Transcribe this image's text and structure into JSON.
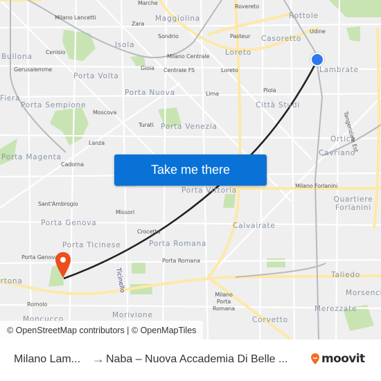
{
  "map": {
    "labels": [
      {
        "text": "Milano Lancetti",
        "kind": "station"
      },
      {
        "text": "Marche",
        "kind": "station"
      },
      {
        "text": "Maggiolina",
        "kind": "district"
      },
      {
        "text": "Zara",
        "kind": "station"
      },
      {
        "text": "Sondrio",
        "kind": "station"
      },
      {
        "text": "Isola",
        "kind": "district"
      },
      {
        "text": "Bullona",
        "kind": "district"
      },
      {
        "text": "Cenisio",
        "kind": "station"
      },
      {
        "text": "Gerusalemme",
        "kind": "station"
      },
      {
        "text": "Gioia",
        "kind": "station"
      },
      {
        "text": "Milano Centrale",
        "kind": "station"
      },
      {
        "text": "Centrale FS",
        "kind": "station"
      },
      {
        "text": "Porta Volta",
        "kind": "district"
      },
      {
        "text": "Porta Nuova",
        "kind": "district"
      },
      {
        "text": "Rovereto",
        "kind": "station"
      },
      {
        "text": "Rottole",
        "kind": "district"
      },
      {
        "text": "Udine",
        "kind": "station"
      },
      {
        "text": "Pasteur",
        "kind": "station"
      },
      {
        "text": "Casoretto",
        "kind": "district"
      },
      {
        "text": "Loreto",
        "kind": "district"
      },
      {
        "text": "Loreto",
        "kind": "station"
      },
      {
        "text": "Lambrate",
        "kind": "district"
      },
      {
        "text": "Lima",
        "kind": "station"
      },
      {
        "text": "Piola",
        "kind": "station"
      },
      {
        "text": "Città Studi",
        "kind": "district"
      },
      {
        "text": "Fiera",
        "kind": "district"
      },
      {
        "text": "Porta Sempione",
        "kind": "district"
      },
      {
        "text": "Moscova",
        "kind": "station"
      },
      {
        "text": "Turati",
        "kind": "station"
      },
      {
        "text": "Porta Venezia",
        "kind": "district"
      },
      {
        "text": "Lanza",
        "kind": "station"
      },
      {
        "text": "Porta Magenta",
        "kind": "district"
      },
      {
        "text": "Cadorna",
        "kind": "station"
      },
      {
        "text": "Ortica",
        "kind": "district"
      },
      {
        "text": "Cavriano",
        "kind": "district"
      },
      {
        "text": "Tangenziale Est",
        "kind": "road"
      },
      {
        "text": "Duomo",
        "kind": "station"
      },
      {
        "text": "Porta Vittoria",
        "kind": "district"
      },
      {
        "text": "Milano Forlanini",
        "kind": "station"
      },
      {
        "text": "Quartiere Forlanini",
        "kind": "district"
      },
      {
        "text": "Sant'Ambrogio",
        "kind": "station"
      },
      {
        "text": "Missori",
        "kind": "station"
      },
      {
        "text": "Porta Genova",
        "kind": "district"
      },
      {
        "text": "Crocetta",
        "kind": "station"
      },
      {
        "text": "Porta Romana",
        "kind": "district"
      },
      {
        "text": "Porta Ticinese",
        "kind": "district"
      },
      {
        "text": "Porta Romana",
        "kind": "station"
      },
      {
        "text": "Porta Genova FS",
        "kind": "station"
      },
      {
        "text": "Calvairate",
        "kind": "district"
      },
      {
        "text": "Ticinello",
        "kind": "road"
      },
      {
        "text": "Taliedo",
        "kind": "district"
      },
      {
        "text": "Morsenchio",
        "kind": "district"
      },
      {
        "text": "Romolo",
        "kind": "station"
      },
      {
        "text": "Milano Porta Romana",
        "kind": "station"
      },
      {
        "text": "Merezzate",
        "kind": "district"
      },
      {
        "text": "Morivione",
        "kind": "district"
      },
      {
        "text": "Corvetto",
        "kind": "district"
      },
      {
        "text": "Moncucco",
        "kind": "district"
      },
      {
        "text": "Tortona",
        "kind": "district"
      }
    ],
    "cta_label": "Take me there",
    "attribution": "© OpenStreetMap contributors | © OpenMapTiles",
    "colors": {
      "route": "#222222",
      "origin": "#2f79f0",
      "destination": "#ee4d1c",
      "button": "#0a72d6",
      "park": "#c9e4b3",
      "major_road": "#fde9a7"
    }
  },
  "footer": {
    "origin": "Milano Lam...",
    "arrow": "→",
    "destination": "Naba – Nuova Accademia Di Belle ...",
    "brand": "moovit"
  }
}
